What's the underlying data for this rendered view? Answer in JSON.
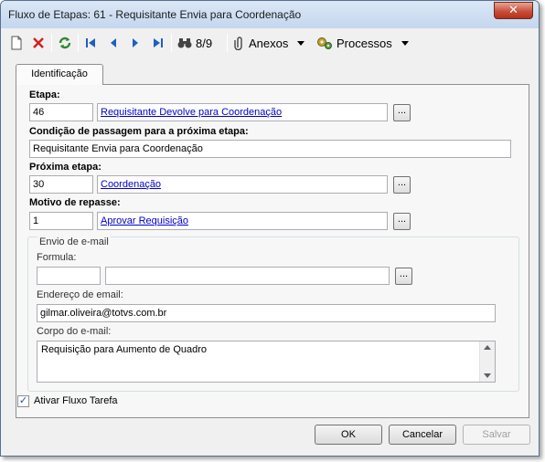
{
  "window": {
    "title": "Fluxo de Etapas: 61 - Requisitante Envia para Coordenação",
    "close_glyph": "✕"
  },
  "toolbar": {
    "record_position": "8/9",
    "anexos_label": "Anexos",
    "processos_label": "Processos"
  },
  "tab": {
    "label": "Identificação"
  },
  "form": {
    "etapa_label": "Etapa:",
    "etapa_code": "46",
    "etapa_name": "Requisitante Devolve para Coordenação",
    "condicao_label": "Condição de passagem para a próxima etapa:",
    "condicao_value": "Requisitante Envia para Coordenação",
    "proxima_label": "Próxima etapa:",
    "proxima_code": "30",
    "proxima_name": "Coordenação",
    "motivo_label": "Motivo de repasse:",
    "motivo_code": "1",
    "motivo_name": "Aprovar Requisição",
    "lookup_label": "..."
  },
  "email": {
    "group_label": "Envio de e-mail",
    "formula_label": "Formula:",
    "formula_code": "",
    "formula_name": "",
    "endereco_label": "Endereço de email:",
    "endereco_value": "gilmar.oliveira@totvs.com.br",
    "corpo_label": "Corpo do e-mail:",
    "corpo_value": "Requisição para Aumento de Quadro"
  },
  "checkbox": {
    "label": "Ativar Fluxo Tarefa",
    "checked": true,
    "mark": "✓"
  },
  "buttons": {
    "ok": "OK",
    "cancel": "Cancelar",
    "save": "Salvar"
  }
}
